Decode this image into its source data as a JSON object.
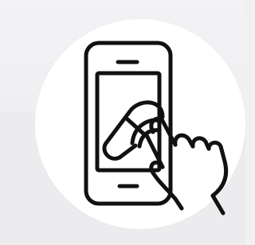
{
  "icon": {
    "name": "smartphone-touch-payment-icon",
    "stroke_color": "#111111",
    "background_color": "#ffffff"
  },
  "background": {
    "base_color": "#efeef1"
  }
}
